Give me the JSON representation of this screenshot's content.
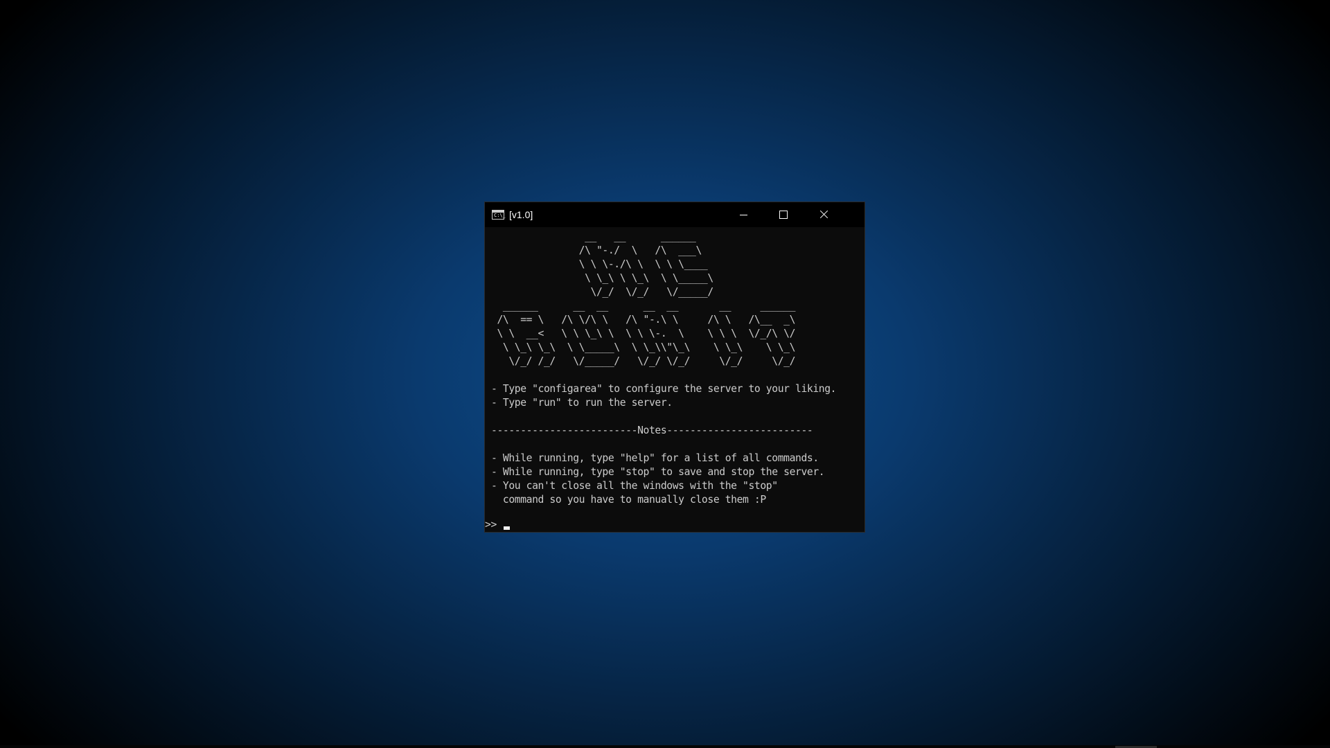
{
  "window": {
    "title": "[v1.0]",
    "icon": "console-icon",
    "icon_glyph": "C:\\_",
    "controls": {
      "minimize_icon": "minimize-icon",
      "maximize_icon": "maximize-icon",
      "close_icon": "close-icon"
    }
  },
  "console": {
    "output": "                __   __      ______\n               /\\ \"-./  \\   /\\  ___\\\n               \\ \\ \\-./\\ \\  \\ \\ \\____\n                \\ \\_\\ \\ \\_\\  \\ \\_____\\\n                 \\/_/  \\/_/   \\/_____/\n  ______      __  __      __  __       __     ______\n /\\  == \\   /\\ \\/\\ \\   /\\ \"-.\\ \\     /\\ \\   /\\__  _\\\n \\ \\  __<   \\ \\ \\_\\ \\  \\ \\ \\-.  \\    \\ \\ \\  \\/_/\\ \\/\n  \\ \\_\\ \\_\\  \\ \\_____\\  \\ \\_\\\\\"\\_\\    \\ \\_\\    \\ \\_\\\n   \\/_/ /_/   \\/_____/   \\/_/ \\/_/     \\/_/     \\/_/\n\n- Type \"configarea\" to configure the server to your liking.\n- Type \"run\" to run the server.\n\n-------------------------Notes-------------------------\n\n- While running, type \"help\" for a list of all commands.\n- While running, type \"stop\" to save and stop the server.\n- You can't close all the windows with the \"stop\"\n  command so you have to manually close them :P",
    "prompt": ">> "
  },
  "colors": {
    "console_bg": "#0c0c0c",
    "console_text": "#cccccc",
    "title_bar_bg": "#000000",
    "desktop_accent": "#0e4f8e"
  }
}
